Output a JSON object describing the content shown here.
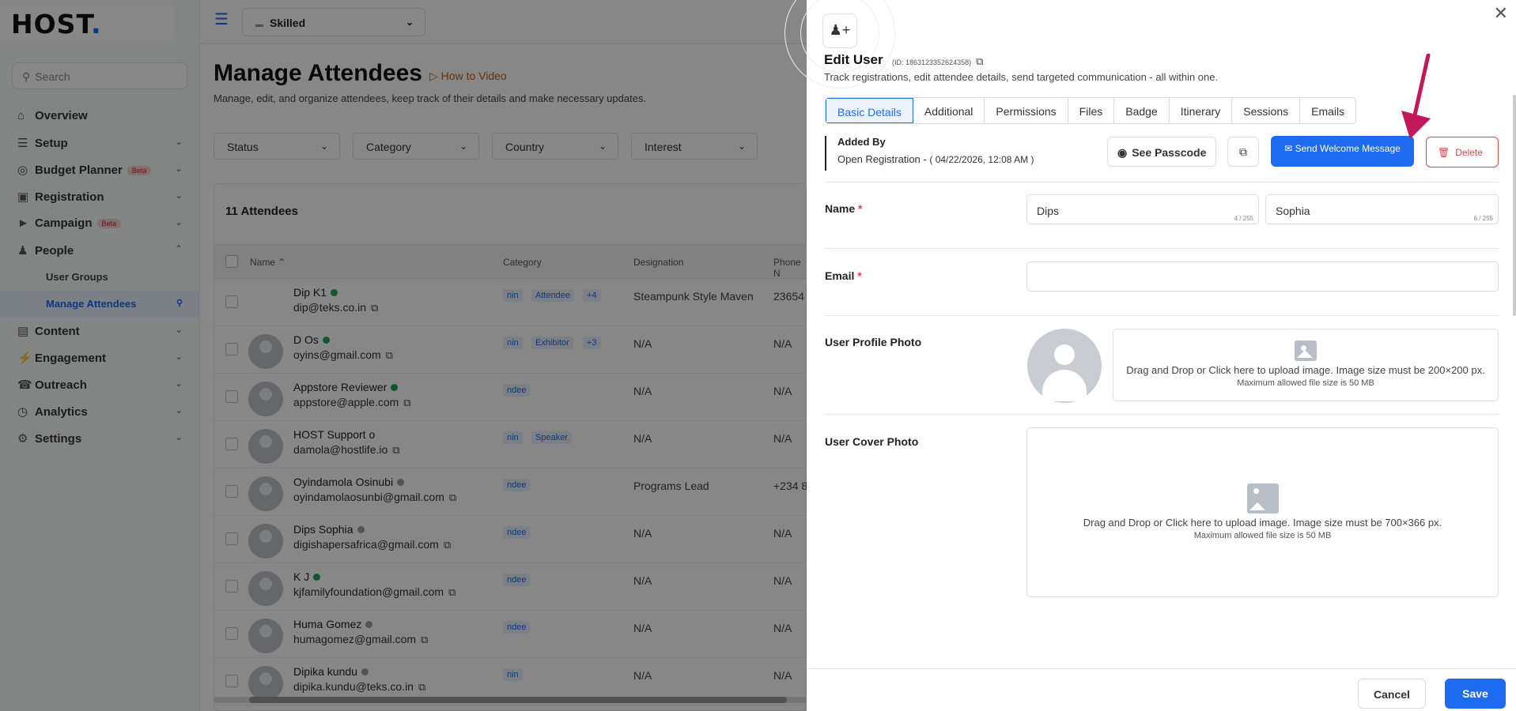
{
  "sidebar": {
    "logo_text": "HOST",
    "logo_dot": ".",
    "search_placeholder": "Search",
    "items": [
      {
        "label": "Overview",
        "icon": "home-icon"
      },
      {
        "label": "Setup",
        "icon": "layers-icon"
      },
      {
        "label": "Budget Planner",
        "icon": "budget-icon",
        "badge": "Beta"
      },
      {
        "label": "Registration",
        "icon": "registration-icon"
      },
      {
        "label": "Campaign",
        "icon": "megaphone-icon",
        "badge": "Beta"
      },
      {
        "label": "People",
        "icon": "people-icon"
      },
      {
        "label": "Content",
        "icon": "content-icon"
      },
      {
        "label": "Engagement",
        "icon": "lightning-icon"
      },
      {
        "label": "Outreach",
        "icon": "outreach-icon"
      },
      {
        "label": "Analytics",
        "icon": "analytics-icon"
      },
      {
        "label": "Settings",
        "icon": "gear-icon"
      }
    ],
    "sub_items": [
      "User Groups",
      "Manage Attendees"
    ]
  },
  "topbar": {
    "workspace": "Skilled"
  },
  "page": {
    "title": "Manage Attendees",
    "how_to": "How to Video",
    "description": "Manage, edit, and organize attendees, keep track of their details and make necessary updates.",
    "filters": [
      "Status",
      "Category",
      "Country",
      "Interest"
    ],
    "attendee_count": "11 Attendees",
    "columns": [
      "Name",
      "Category",
      "Designation",
      "Phone N"
    ]
  },
  "attendees": [
    {
      "name": "Dip K1",
      "email": "dip@teks.co.in",
      "status": "online",
      "cat1": "nin",
      "cat2": "Attendee",
      "cat3": "+4",
      "designation": "Steampunk Style Maven",
      "phone": "23654"
    },
    {
      "name": "D Os",
      "email": "oyins@gmail.com",
      "status": "online",
      "cat1": "nin",
      "cat2": "Exhibitor",
      "cat3": "+3",
      "designation": "N/A",
      "phone": "N/A"
    },
    {
      "name": "Appstore Reviewer",
      "email": "appstore@apple.com",
      "status": "online",
      "cat1": "ndee",
      "cat2": "",
      "cat3": "",
      "designation": "N/A",
      "phone": "N/A"
    },
    {
      "name": "HOST Support o",
      "email": "damola@hostlife.io",
      "status": "",
      "cat1": "nin",
      "cat2": "Speaker",
      "cat3": "",
      "designation": "N/A",
      "phone": "N/A"
    },
    {
      "name": "Oyindamola Osinubi",
      "email": "oyindamolaosunbi@gmail.com",
      "status": "offline",
      "cat1": "ndee",
      "cat2": "",
      "cat3": "",
      "designation": "Programs Lead",
      "phone": "+234 8"
    },
    {
      "name": "Dips Sophia",
      "email": "digishapersafrica@gmail.com",
      "status": "offline",
      "cat1": "ndee",
      "cat2": "",
      "cat3": "",
      "designation": "N/A",
      "phone": "N/A"
    },
    {
      "name": "K J",
      "email": "kjfamilyfoundation@gmail.com",
      "status": "online",
      "cat1": "ndee",
      "cat2": "",
      "cat3": "",
      "designation": "N/A",
      "phone": "N/A"
    },
    {
      "name": "Huma Gomez",
      "email": "humagomez@gmail.com",
      "status": "offline",
      "cat1": "ndee",
      "cat2": "",
      "cat3": "",
      "designation": "N/A",
      "phone": "N/A"
    },
    {
      "name": "Dipika kundu",
      "email": "dipika.kundu@teks.co.in",
      "status": "offline",
      "cat1": "nin",
      "cat2": "",
      "cat3": "",
      "designation": "N/A",
      "phone": "N/A"
    }
  ],
  "panel": {
    "title": "Edit User",
    "id_text": "(ID: 1863123352624358)",
    "description": "Track registrations, edit attendee details, send targeted communication - all within one.",
    "tabs": [
      "Basic Details",
      "Additional",
      "Permissions",
      "Files",
      "Badge",
      "Itinerary",
      "Sessions",
      "Emails"
    ],
    "active_tab": "Basic Details",
    "added_by_label": "Added By",
    "added_by_value": "Open Registration -",
    "added_by_date": "( 04/22/2026, 12:08 AM )",
    "see_passcode": "See Passcode",
    "send_welcome": "Send Welcome Message",
    "delete": "Delete",
    "name_label": "Name",
    "first_name": "Dips",
    "first_name_count": "4 / 255",
    "last_name": "Sophia",
    "last_name_count": "6 / 255",
    "email_label": "Email",
    "email_value": "",
    "profile_photo_label": "User Profile Photo",
    "profile_upload_text": "Drag and Drop or Click here to upload image. Image size must be 200×200 px.",
    "profile_upload_max": "Maximum allowed file size is 50 MB",
    "cover_photo_label": "User Cover Photo",
    "cover_upload_text": "Drag and Drop or Click here to upload image. Image size must be 700×366 px.",
    "cover_upload_max": "Maximum allowed file size is 50 MB",
    "cancel": "Cancel",
    "save": "Save",
    "required_mark": "*"
  },
  "colors": {
    "accent": "#1d6bf0",
    "danger": "#e04545",
    "annotation_arrow": "#c2185b",
    "online": "#22a55b",
    "offline": "#9aa0a6"
  }
}
